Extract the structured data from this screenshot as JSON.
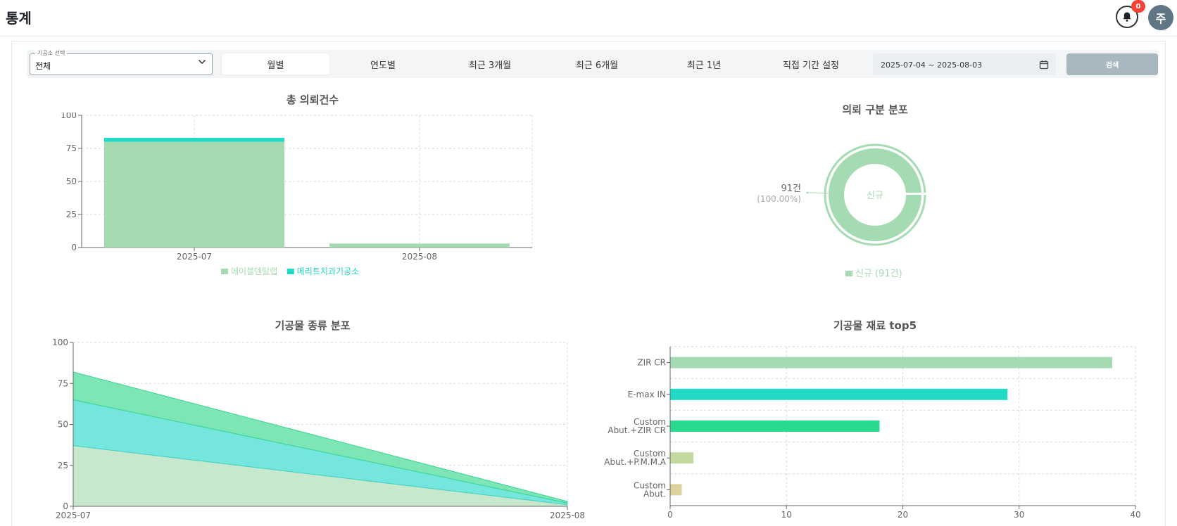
{
  "header": {
    "title": "통계",
    "notification_count": "0",
    "avatar_initial": "주"
  },
  "filters": {
    "lab_select": {
      "label": "기공소 선택",
      "value": "전체"
    },
    "periods": [
      "월별",
      "연도별",
      "최근 3개월",
      "최근 6개월",
      "최근 1년",
      "직접 기간 설정"
    ],
    "active_period": "월별",
    "date_range": "2025-07-04 ~ 2025-08-03",
    "search_label": "검색"
  },
  "colors": {
    "green": "#a5dbb2",
    "teal": "#22d8c6",
    "bright_green": "#29d98e",
    "olive": "#c3d9a0",
    "khaki": "#dad39c"
  },
  "icons": {
    "notification": "bell-icon",
    "date": "calendar-icon",
    "select": "chevron-down-icon"
  },
  "chart_data": [
    {
      "type": "bar",
      "title": "총 의뢰건수",
      "stacked": true,
      "categories": [
        "2025-07",
        "2025-08"
      ],
      "series": [
        {
          "name": "에이블덴탈랩",
          "color": "#a5dbb2",
          "values": [
            80,
            3
          ]
        },
        {
          "name": "메리트치과기공소",
          "color": "#22d8c6",
          "values": [
            3,
            0
          ]
        }
      ],
      "ylim": [
        0,
        100
      ],
      "yticks": [
        0,
        25,
        50,
        75,
        100
      ],
      "grid": true,
      "legend": "bottom"
    },
    {
      "type": "pie",
      "title": "의뢰 구분 분포",
      "donut": true,
      "slices": [
        {
          "name": "신규",
          "value": 91,
          "percent": "100.00%",
          "color": "#a5dbb2"
        }
      ],
      "center_label": "신규",
      "callout_value": "91건",
      "callout_percent": "(100.00%)",
      "legend_text": "신규 (91건)",
      "legend": "bottom"
    },
    {
      "type": "area",
      "title": "기공물 종류 분포",
      "stacked": true,
      "x": [
        "2025-07",
        "2025-08"
      ],
      "series": [
        {
          "color": "#c8e8cd",
          "values": [
            37,
            1
          ]
        },
        {
          "color": "#74e6dd",
          "values": [
            28,
            1
          ]
        },
        {
          "color": "#7ee6b4",
          "values": [
            17,
            1
          ]
        }
      ],
      "ylim": [
        0,
        100
      ],
      "yticks": [
        0,
        25,
        50,
        75,
        100
      ],
      "grid": true
    },
    {
      "type": "bar",
      "orientation": "horizontal",
      "title": "기공물 재료 top5",
      "categories": [
        [
          "ZIR CR"
        ],
        [
          "E-max IN"
        ],
        [
          "Custom",
          "Abut.+ZIR CR"
        ],
        [
          "Custom",
          "Abut.+P.M.M.A"
        ],
        [
          "Custom",
          "Abut."
        ]
      ],
      "values": [
        38,
        29,
        18,
        2,
        1
      ],
      "colors": [
        "#a5dbb2",
        "#22d8c6",
        "#29d98e",
        "#c3d9a0",
        "#dad39c"
      ],
      "xlim": [
        0,
        40
      ],
      "xticks": [
        0,
        10,
        20,
        30,
        40
      ],
      "grid": true
    }
  ]
}
